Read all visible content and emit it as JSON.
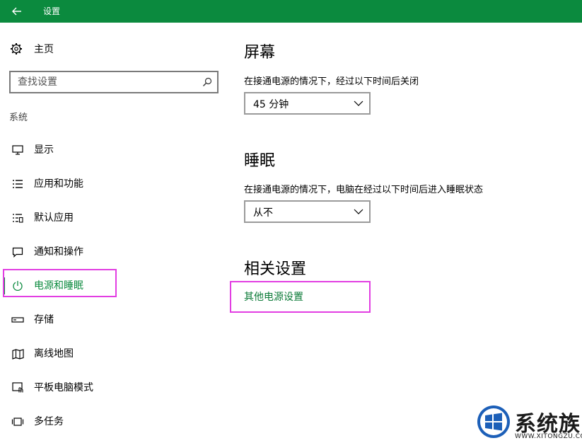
{
  "window": {
    "title": "设置"
  },
  "sidebar": {
    "home_label": "主页",
    "search_placeholder": "查找设置",
    "group_label": "系统",
    "items": [
      {
        "label": "显示",
        "icon": "monitor-icon"
      },
      {
        "label": "应用和功能",
        "icon": "app-list-icon"
      },
      {
        "label": "默认应用",
        "icon": "default-apps-icon"
      },
      {
        "label": "通知和操作",
        "icon": "notification-icon"
      },
      {
        "label": "电源和睡眠",
        "icon": "power-icon",
        "active": true
      },
      {
        "label": "存储",
        "icon": "storage-icon"
      },
      {
        "label": "离线地图",
        "icon": "map-icon"
      },
      {
        "label": "平板电脑模式",
        "icon": "tablet-mode-icon"
      },
      {
        "label": "多任务",
        "icon": "multitask-icon"
      }
    ]
  },
  "content": {
    "screen": {
      "heading": "屏幕",
      "description": "在接通电源的情况下，经过以下时间后关闭",
      "selected": "45 分钟"
    },
    "sleep": {
      "heading": "睡眠",
      "description": "在接通电源的情况下，电脑在经过以下时间后进入睡眠状态",
      "selected": "从不"
    },
    "related": {
      "heading": "相关设置",
      "link": "其他电源设置"
    }
  },
  "watermark": {
    "brand": "系统族",
    "url": "WWW.XITONGZU.COM"
  },
  "colors": {
    "accent": "#0b8a3e",
    "highlight": "#e23ee2"
  }
}
